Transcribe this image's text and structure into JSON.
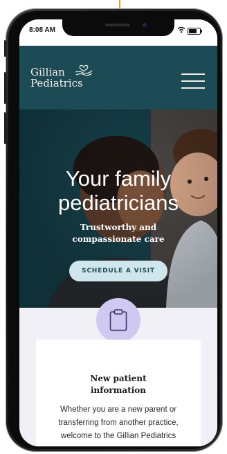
{
  "status_bar": {
    "time": "8:08 AM"
  },
  "header": {
    "logo_line1": "Gillian",
    "logo_line2": "Pediatrics",
    "menu_icon": "hamburger-icon"
  },
  "hero": {
    "title_line1": "Your family",
    "title_line2": "pediatricians",
    "subtitle_line1": "Trustworthy and",
    "subtitle_line2": "compassionate care",
    "cta_label": "SCHEDULE A VISIT"
  },
  "card": {
    "icon": "clipboard-icon",
    "title_line1": "New patient",
    "title_line2": "information",
    "body_line1": "Whether you are a new parent or",
    "body_line2": "transferring from another practice,",
    "body_line3": "welcome to the Gillian Pediatrics"
  },
  "colors": {
    "header_bg": "#1c4b56",
    "cta_bg": "#cfe6ec",
    "badge_bg": "#cfc8f0",
    "page_bg": "#f1f0f7",
    "arrow": "#f0a020"
  }
}
